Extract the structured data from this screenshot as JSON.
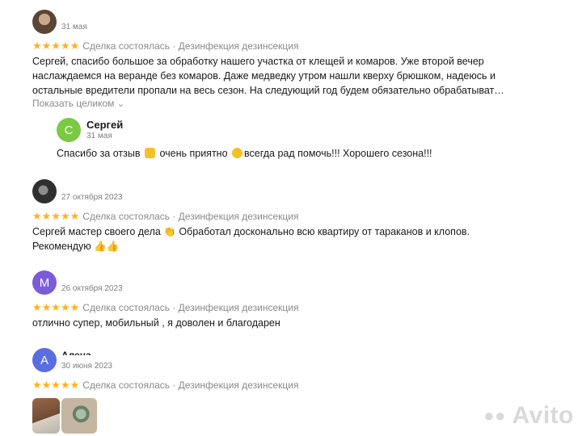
{
  "reviews": [
    {
      "date": "31 мая",
      "meta": "Сделка состоялась · Дезинфекция дезинсекция",
      "text_lines": [
        "Сергей, спасибо большое за обработку нашего участка от клещей и комаров. Уже второй вечер",
        "наслаждаемся на веранде без комаров. Даже медведку утром нашли кверху брюшком, надеюсь и",
        "остальные вредители пропали на весь сезон. На следующий год будем обязательно обрабатыват…"
      ],
      "expand_label": "Показать целиком",
      "reply": {
        "avatar_letter": "С",
        "name": "Сергей",
        "date": "31 мая",
        "text_before": "Спасибо за отзыв",
        "text_middle": "очень приятно",
        "text_after": "всегда рад помочь!!! Хорошего сезона!!!"
      }
    },
    {
      "date": "27 октября 2023",
      "meta": "Сделка состоялась · Дезинфекция дезинсекция",
      "text_lines": [
        "Сергей мастер своего дела 👏 Обработал досконально всю квартиру от тараканов и клопов.",
        "Рекомендую 👍👍"
      ]
    },
    {
      "avatar_letter": "М",
      "date": "26 октября 2023",
      "meta": "Сделка состоялась · Дезинфекция дезинсекция",
      "text_lines": [
        "отлично супер, мобильный , я доволен и благодарен"
      ]
    },
    {
      "avatar_letter": "А",
      "name": "Алена",
      "date": "30 июня 2023",
      "meta": "Сделка состоялась · Дезинфекция дезинсекция"
    }
  ],
  "stars": "★★★★★",
  "watermark": "Avito",
  "colors": {
    "star": "#ffb021",
    "avatar_c": "#7ac943",
    "avatar_m": "#7b5bd6",
    "avatar_a": "#5b6ee1"
  }
}
